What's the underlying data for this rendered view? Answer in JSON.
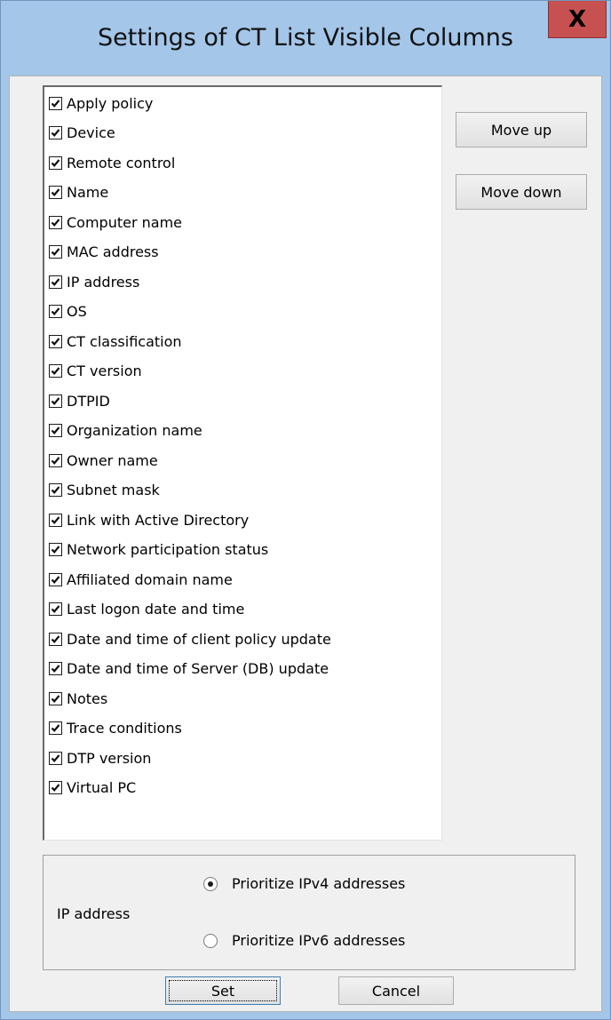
{
  "window": {
    "title": "Settings of CT List Visible Columns",
    "close_label": "X"
  },
  "columns": [
    {
      "label": "Apply policy",
      "checked": true
    },
    {
      "label": "Device",
      "checked": true
    },
    {
      "label": "Remote control",
      "checked": true
    },
    {
      "label": "Name",
      "checked": true
    },
    {
      "label": "Computer name",
      "checked": true
    },
    {
      "label": "MAC address",
      "checked": true
    },
    {
      "label": "IP address",
      "checked": true
    },
    {
      "label": "OS",
      "checked": true
    },
    {
      "label": "CT classification",
      "checked": true
    },
    {
      "label": "CT version",
      "checked": true
    },
    {
      "label": "DTPID",
      "checked": true
    },
    {
      "label": "Organization name",
      "checked": true
    },
    {
      "label": "Owner name",
      "checked": true
    },
    {
      "label": "Subnet mask",
      "checked": true
    },
    {
      "label": "Link with Active Directory",
      "checked": true
    },
    {
      "label": "Network participation status",
      "checked": true
    },
    {
      "label": "Affiliated domain name",
      "checked": true
    },
    {
      "label": "Last logon date and time",
      "checked": true
    },
    {
      "label": "Date and time of client policy update",
      "checked": true
    },
    {
      "label": "Date and time of Server (DB) update",
      "checked": true
    },
    {
      "label": "Notes",
      "checked": true
    },
    {
      "label": "Trace conditions",
      "checked": true
    },
    {
      "label": "DTP version",
      "checked": true
    },
    {
      "label": "Virtual PC",
      "checked": true
    }
  ],
  "buttons": {
    "move_up": "Move up",
    "move_down": "Move down",
    "set": "Set",
    "cancel": "Cancel"
  },
  "ip_group": {
    "label": "IP address",
    "options": [
      {
        "label": "Prioritize IPv4 addresses",
        "selected": true
      },
      {
        "label": "Prioritize IPv6 addresses",
        "selected": false
      }
    ]
  },
  "colors": {
    "frame": "#a3c6e9",
    "close": "#c75050",
    "dialog": "#f0f0f0"
  }
}
